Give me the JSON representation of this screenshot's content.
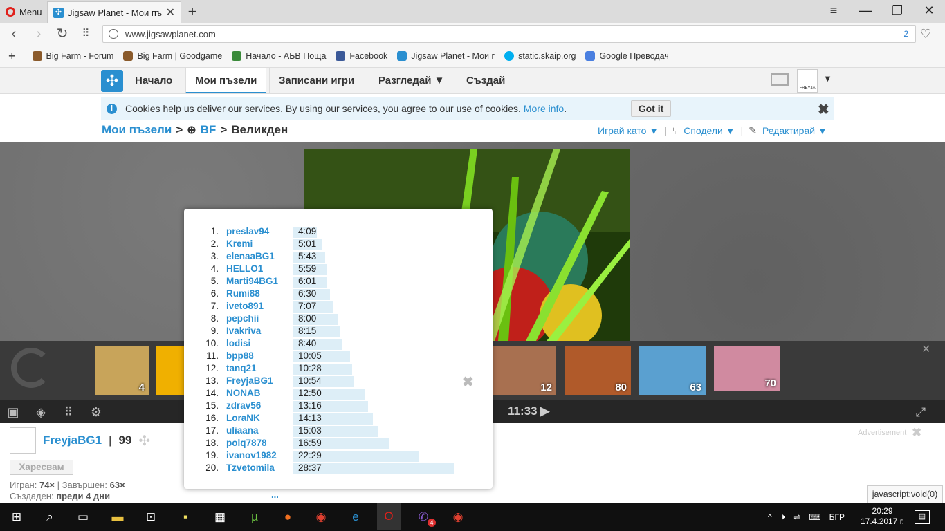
{
  "browser": {
    "menu_label": "Menu",
    "tab_title": "Jigsaw Planet - Мои пъзел",
    "url": "www.jigsawplanet.com",
    "badge_count": "2",
    "bookmarks": [
      {
        "label": "Big Farm - Forum",
        "color": "#8a5a2b"
      },
      {
        "label": "Big Farm | Goodgame",
        "color": "#8a5a2b"
      },
      {
        "label": "Начало - АБВ Поща",
        "color": "#3a8a3a"
      },
      {
        "label": "Facebook",
        "color": "#3b5998"
      },
      {
        "label": "Jigsaw Planet - Мои г",
        "color": "#2a8fd0"
      },
      {
        "label": "static.skaip.org",
        "color": "#00aff0"
      },
      {
        "label": "Google Преводач",
        "color": "#4a7fe0"
      }
    ]
  },
  "site": {
    "nav": [
      "Начало",
      "Мои пъзели",
      "Записани игри",
      "Разгледай ▼",
      "Създай"
    ],
    "avatar_text": "FREYJA",
    "cookie_text": "Cookies help us deliver our services. By using our services, you agree to our use of cookies.",
    "cookie_link": "More info",
    "cookie_button": "Got it",
    "breadcrumb": {
      "root": "Мои пъзели",
      "folder": "BF",
      "current": "Великден"
    },
    "actions": [
      "Играй като ▼",
      "Сподели ▼",
      "Редактирай ▼"
    ]
  },
  "thumbs": [
    {
      "count": "4",
      "color": "#c8a45a"
    },
    {
      "count": "",
      "color": "#f0b000"
    },
    {
      "count": "12",
      "color": "#a87050"
    },
    {
      "count": "80",
      "color": "#b05a2a"
    },
    {
      "count": "63",
      "color": "#5aa0d0"
    },
    {
      "count": "70",
      "color": "#d08aa0"
    }
  ],
  "timer": "11:33",
  "user": {
    "name": "FreyjaBG1",
    "sep": "|",
    "count": "99",
    "like": "Харесвам",
    "played_label": "Игран:",
    "played": "74×",
    "finished_label": "Завършен:",
    "finished": "63×",
    "created_label": "Създаден:",
    "created": "преди 4 дни",
    "more": "..."
  },
  "ad_label": "Advertisement",
  "status_text": "javascript:void(0)",
  "leaderboard": [
    {
      "rank": "1.",
      "name": "preslav94",
      "time": "4:09",
      "seconds": 249
    },
    {
      "rank": "2.",
      "name": "Kremi",
      "time": "5:01",
      "seconds": 301
    },
    {
      "rank": "3.",
      "name": "elenaaBG1",
      "time": "5:43",
      "seconds": 343
    },
    {
      "rank": "4.",
      "name": "HELLO1",
      "time": "5:59",
      "seconds": 359
    },
    {
      "rank": "5.",
      "name": "Marti94BG1",
      "time": "6:01",
      "seconds": 361
    },
    {
      "rank": "6.",
      "name": "Rumi88",
      "time": "6:30",
      "seconds": 390
    },
    {
      "rank": "7.",
      "name": "iveto891",
      "time": "7:07",
      "seconds": 427
    },
    {
      "rank": "8.",
      "name": "pepchii",
      "time": "8:00",
      "seconds": 480
    },
    {
      "rank": "9.",
      "name": "Ivakriva",
      "time": "8:15",
      "seconds": 495
    },
    {
      "rank": "10.",
      "name": "lodisi",
      "time": "8:40",
      "seconds": 520
    },
    {
      "rank": "11.",
      "name": "bpp88",
      "time": "10:05",
      "seconds": 605
    },
    {
      "rank": "12.",
      "name": "tanq21",
      "time": "10:28",
      "seconds": 628
    },
    {
      "rank": "13.",
      "name": "FreyjaBG1",
      "time": "10:54",
      "seconds": 654
    },
    {
      "rank": "14.",
      "name": "NONAB",
      "time": "12:50",
      "seconds": 770
    },
    {
      "rank": "15.",
      "name": "zdrav56",
      "time": "13:16",
      "seconds": 796
    },
    {
      "rank": "16.",
      "name": "LoraNK",
      "time": "14:13",
      "seconds": 853
    },
    {
      "rank": "17.",
      "name": "uliaana",
      "time": "15:03",
      "seconds": 903
    },
    {
      "rank": "18.",
      "name": "polq7878",
      "time": "16:59",
      "seconds": 1019
    },
    {
      "rank": "19.",
      "name": "ivanov1982",
      "time": "22:29",
      "seconds": 1349
    },
    {
      "rank": "20.",
      "name": "Tzvetomila",
      "time": "28:37",
      "seconds": 1717
    }
  ],
  "taskbar": {
    "lang": "БГР",
    "time": "20:29",
    "date": "17.4.2017 г.",
    "viber_badge": "4"
  }
}
